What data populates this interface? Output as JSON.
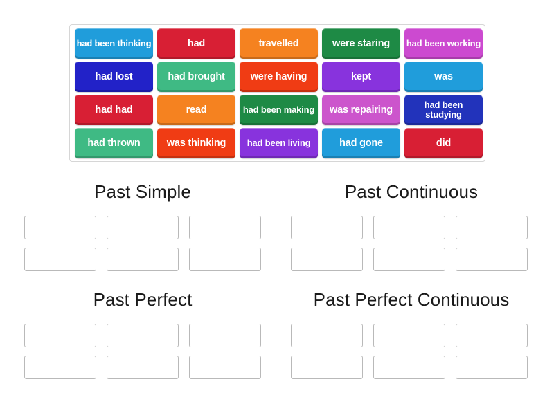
{
  "activity": {
    "type": "group-sort",
    "word_bank": {
      "rows": [
        [
          {
            "label": "had been thinking",
            "color": "#209ddb",
            "lines": 2
          },
          {
            "label": "had",
            "color": "#d81f34",
            "lines": 1
          },
          {
            "label": "travelled",
            "color": "#f58220",
            "lines": 1
          },
          {
            "label": "were staring",
            "color": "#1e8a45",
            "lines": 1
          },
          {
            "label": "had been working",
            "color": "#cc4ad0",
            "lines": 2
          }
        ],
        [
          {
            "label": "had lost",
            "color": "#2222c8",
            "lines": 1
          },
          {
            "label": "had brought",
            "color": "#3fba84",
            "lines": 1
          },
          {
            "label": "were having",
            "color": "#f03c14",
            "lines": 1
          },
          {
            "label": "kept",
            "color": "#8833dd",
            "lines": 1
          },
          {
            "label": "was",
            "color": "#209ddb",
            "lines": 1
          }
        ],
        [
          {
            "label": "had had",
            "color": "#d81f34",
            "lines": 1
          },
          {
            "label": "read",
            "color": "#f58220",
            "lines": 1
          },
          {
            "label": "had been making",
            "color": "#1e8a45",
            "lines": 2
          },
          {
            "label": "was repairing",
            "color": "#cc55cc",
            "lines": 1
          },
          {
            "label": "had been studying",
            "color": "#2233bb",
            "lines": 2
          }
        ],
        [
          {
            "label": "had thrown",
            "color": "#3fba84",
            "lines": 1
          },
          {
            "label": "was thinking",
            "color": "#f03c14",
            "lines": 1
          },
          {
            "label": "had been living",
            "color": "#8833dd",
            "lines": 2
          },
          {
            "label": "had gone",
            "color": "#209ddb",
            "lines": 1
          },
          {
            "label": "did",
            "color": "#d81f34",
            "lines": 1
          }
        ]
      ]
    },
    "categories": [
      {
        "title": "Past Simple",
        "zone_count": 6
      },
      {
        "title": "Past Continuous",
        "zone_count": 6
      },
      {
        "title": "Past Perfect",
        "zone_count": 6
      },
      {
        "title": "Past Perfect Continuous",
        "zone_count": 6
      }
    ]
  }
}
